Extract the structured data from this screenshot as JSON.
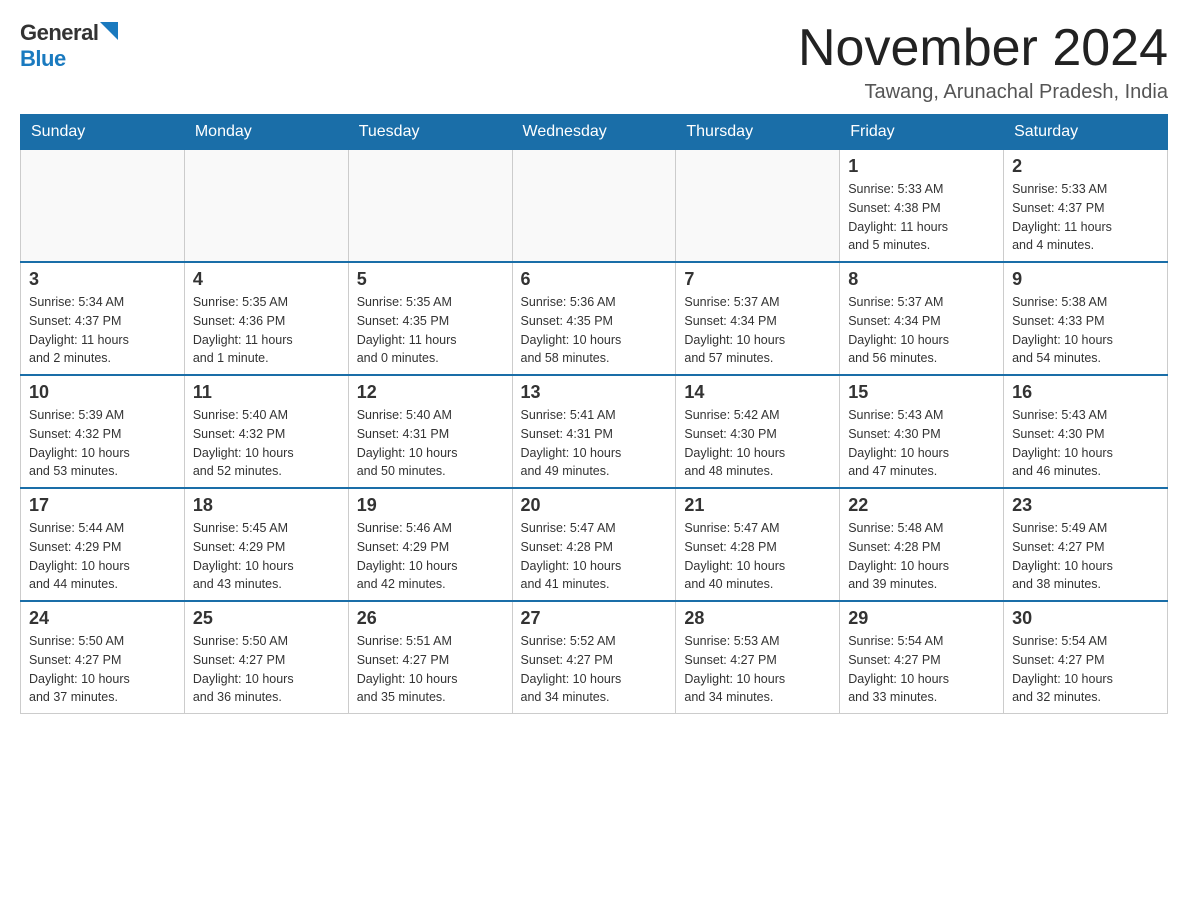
{
  "header": {
    "logo_general": "General",
    "logo_blue": "Blue",
    "month_title": "November 2024",
    "location": "Tawang, Arunachal Pradesh, India"
  },
  "days_of_week": [
    "Sunday",
    "Monday",
    "Tuesday",
    "Wednesday",
    "Thursday",
    "Friday",
    "Saturday"
  ],
  "weeks": [
    [
      {
        "day": "",
        "info": ""
      },
      {
        "day": "",
        "info": ""
      },
      {
        "day": "",
        "info": ""
      },
      {
        "day": "",
        "info": ""
      },
      {
        "day": "",
        "info": ""
      },
      {
        "day": "1",
        "info": "Sunrise: 5:33 AM\nSunset: 4:38 PM\nDaylight: 11 hours\nand 5 minutes."
      },
      {
        "day": "2",
        "info": "Sunrise: 5:33 AM\nSunset: 4:37 PM\nDaylight: 11 hours\nand 4 minutes."
      }
    ],
    [
      {
        "day": "3",
        "info": "Sunrise: 5:34 AM\nSunset: 4:37 PM\nDaylight: 11 hours\nand 2 minutes."
      },
      {
        "day": "4",
        "info": "Sunrise: 5:35 AM\nSunset: 4:36 PM\nDaylight: 11 hours\nand 1 minute."
      },
      {
        "day": "5",
        "info": "Sunrise: 5:35 AM\nSunset: 4:35 PM\nDaylight: 11 hours\nand 0 minutes."
      },
      {
        "day": "6",
        "info": "Sunrise: 5:36 AM\nSunset: 4:35 PM\nDaylight: 10 hours\nand 58 minutes."
      },
      {
        "day": "7",
        "info": "Sunrise: 5:37 AM\nSunset: 4:34 PM\nDaylight: 10 hours\nand 57 minutes."
      },
      {
        "day": "8",
        "info": "Sunrise: 5:37 AM\nSunset: 4:34 PM\nDaylight: 10 hours\nand 56 minutes."
      },
      {
        "day": "9",
        "info": "Sunrise: 5:38 AM\nSunset: 4:33 PM\nDaylight: 10 hours\nand 54 minutes."
      }
    ],
    [
      {
        "day": "10",
        "info": "Sunrise: 5:39 AM\nSunset: 4:32 PM\nDaylight: 10 hours\nand 53 minutes."
      },
      {
        "day": "11",
        "info": "Sunrise: 5:40 AM\nSunset: 4:32 PM\nDaylight: 10 hours\nand 52 minutes."
      },
      {
        "day": "12",
        "info": "Sunrise: 5:40 AM\nSunset: 4:31 PM\nDaylight: 10 hours\nand 50 minutes."
      },
      {
        "day": "13",
        "info": "Sunrise: 5:41 AM\nSunset: 4:31 PM\nDaylight: 10 hours\nand 49 minutes."
      },
      {
        "day": "14",
        "info": "Sunrise: 5:42 AM\nSunset: 4:30 PM\nDaylight: 10 hours\nand 48 minutes."
      },
      {
        "day": "15",
        "info": "Sunrise: 5:43 AM\nSunset: 4:30 PM\nDaylight: 10 hours\nand 47 minutes."
      },
      {
        "day": "16",
        "info": "Sunrise: 5:43 AM\nSunset: 4:30 PM\nDaylight: 10 hours\nand 46 minutes."
      }
    ],
    [
      {
        "day": "17",
        "info": "Sunrise: 5:44 AM\nSunset: 4:29 PM\nDaylight: 10 hours\nand 44 minutes."
      },
      {
        "day": "18",
        "info": "Sunrise: 5:45 AM\nSunset: 4:29 PM\nDaylight: 10 hours\nand 43 minutes."
      },
      {
        "day": "19",
        "info": "Sunrise: 5:46 AM\nSunset: 4:29 PM\nDaylight: 10 hours\nand 42 minutes."
      },
      {
        "day": "20",
        "info": "Sunrise: 5:47 AM\nSunset: 4:28 PM\nDaylight: 10 hours\nand 41 minutes."
      },
      {
        "day": "21",
        "info": "Sunrise: 5:47 AM\nSunset: 4:28 PM\nDaylight: 10 hours\nand 40 minutes."
      },
      {
        "day": "22",
        "info": "Sunrise: 5:48 AM\nSunset: 4:28 PM\nDaylight: 10 hours\nand 39 minutes."
      },
      {
        "day": "23",
        "info": "Sunrise: 5:49 AM\nSunset: 4:27 PM\nDaylight: 10 hours\nand 38 minutes."
      }
    ],
    [
      {
        "day": "24",
        "info": "Sunrise: 5:50 AM\nSunset: 4:27 PM\nDaylight: 10 hours\nand 37 minutes."
      },
      {
        "day": "25",
        "info": "Sunrise: 5:50 AM\nSunset: 4:27 PM\nDaylight: 10 hours\nand 36 minutes."
      },
      {
        "day": "26",
        "info": "Sunrise: 5:51 AM\nSunset: 4:27 PM\nDaylight: 10 hours\nand 35 minutes."
      },
      {
        "day": "27",
        "info": "Sunrise: 5:52 AM\nSunset: 4:27 PM\nDaylight: 10 hours\nand 34 minutes."
      },
      {
        "day": "28",
        "info": "Sunrise: 5:53 AM\nSunset: 4:27 PM\nDaylight: 10 hours\nand 34 minutes."
      },
      {
        "day": "29",
        "info": "Sunrise: 5:54 AM\nSunset: 4:27 PM\nDaylight: 10 hours\nand 33 minutes."
      },
      {
        "day": "30",
        "info": "Sunrise: 5:54 AM\nSunset: 4:27 PM\nDaylight: 10 hours\nand 32 minutes."
      }
    ]
  ]
}
